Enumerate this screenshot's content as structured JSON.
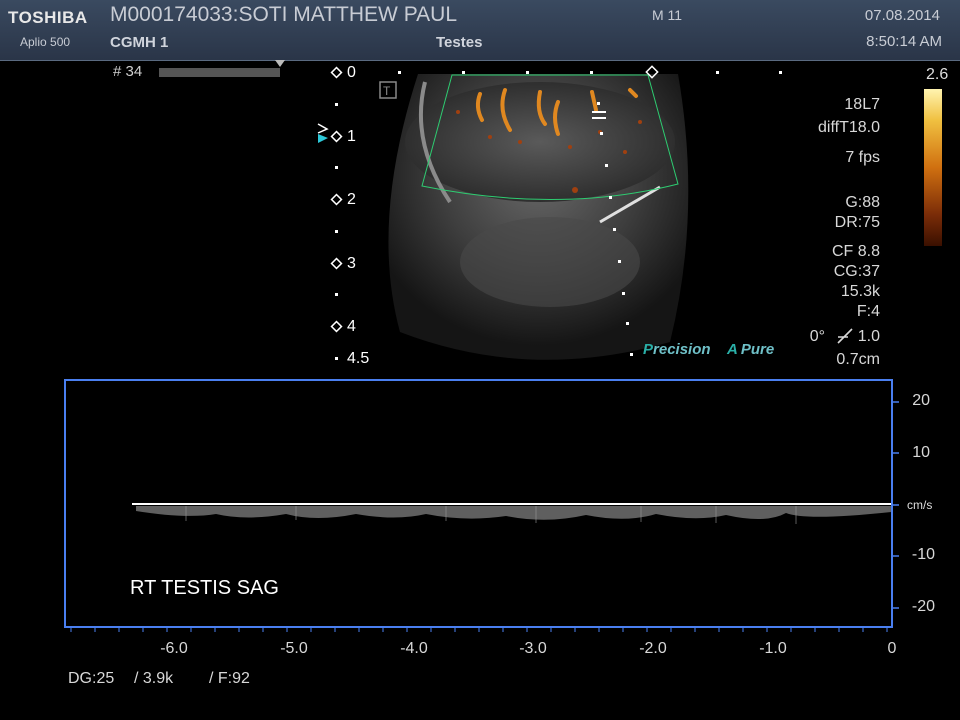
{
  "header": {
    "brand": "TOSHIBA",
    "model": "Aplio 500",
    "patient": "M000174033:SOTI MATTHEW PAUL",
    "institution": "CGMH 1",
    "mode": "M 11",
    "preset": "Testes",
    "date": "07.08.2014",
    "time": "8:50:14 AM"
  },
  "frame": {
    "label": "# 34"
  },
  "depth_scale": {
    "labels": [
      "0",
      "1",
      "2",
      "3",
      "4",
      "4.5"
    ],
    "focus_marker": "arrow-marker-icon"
  },
  "params": {
    "probe": "18L7",
    "harmonic": "diffT18.0",
    "fps": "7 fps",
    "gain": "G:88",
    "dr": "DR:75",
    "cf": "CF 8.8",
    "cg": "CG:37",
    "prf": "15.3k",
    "filter": "F:4",
    "angle": "0°",
    "angle_value": "1.0",
    "gate": "0.7cm"
  },
  "color_scale": {
    "max": "2.6",
    "colors": [
      "#fff4b0",
      "#f0c040",
      "#d07010",
      "#7a2c08",
      "#3a1000"
    ]
  },
  "features": {
    "precision_p": "P",
    "precision_rest": "recision",
    "pure_a": "A",
    "pure_rest": "Pure"
  },
  "doppler": {
    "label": "RT TESTIS SAG",
    "unit": "cm/s",
    "velocity_ticks": [
      "20",
      "10",
      "-10",
      "-20"
    ],
    "time_ticks": [
      "-6.0",
      "-5.0",
      "-4.0",
      "-3.0",
      "-2.0",
      "-1.0",
      "0"
    ],
    "baseline_color": "#ffffff",
    "border_color": "#4a7ff0"
  },
  "footer": {
    "dg": "DG:25",
    "prf": "/ 3.9k",
    "filter": "/ F:92"
  }
}
